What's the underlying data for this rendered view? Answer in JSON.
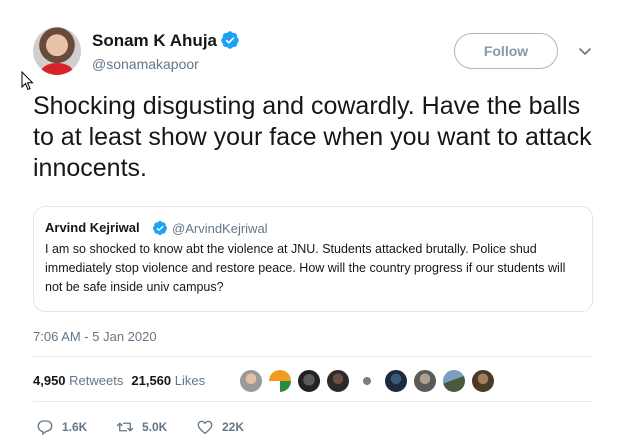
{
  "author": {
    "name": "Sonam K Ahuja",
    "handle": "@sonamakapoor",
    "verified": true
  },
  "follow_button": {
    "label": "Follow"
  },
  "tweet_text": "Shocking disgusting and cowardly. Have the balls to at least show your face when you want to attack innocents.",
  "quoted_tweet": {
    "name": "Arvind Kejriwal",
    "handle": "@ArvindKejriwal",
    "verified": true,
    "text": "I am so shocked to know abt the violence at JNU. Students attacked brutally. Police shud immediately stop violence and restore peace. How will the country progress if our students will not be safe inside univ campus?"
  },
  "timestamp": "7:06 AM - 5 Jan 2020",
  "stats": {
    "retweets_count": "4,950",
    "retweets_label": "Retweets",
    "likes_count": "21,560",
    "likes_label": "Likes"
  },
  "likers_icons": [
    "avatar",
    "avatar",
    "avatar",
    "avatar",
    "avatar",
    "avatar",
    "avatar",
    "avatar",
    "avatar"
  ],
  "actions": {
    "replies": "1.6K",
    "retweets": "5.0K",
    "likes": "22K"
  },
  "colors": {
    "verified": "#1da1f2",
    "text_primary": "#14171a",
    "text_secondary": "#657786",
    "border": "#e1e8ed"
  }
}
